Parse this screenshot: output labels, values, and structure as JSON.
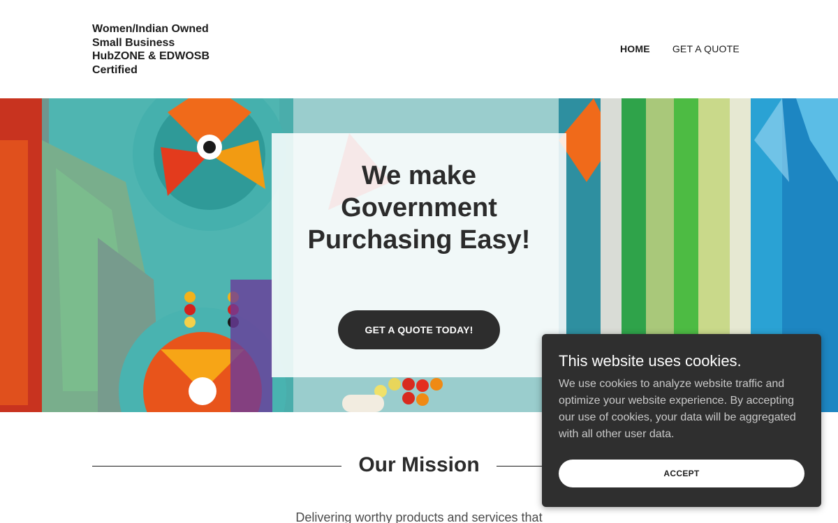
{
  "header": {
    "brand_lines": [
      "Women/Indian Owned",
      "Small Business",
      "HubZONE & EDWOSB",
      "Certified"
    ],
    "nav": [
      {
        "label": "HOME",
        "active": true
      },
      {
        "label": "GET A QUOTE",
        "active": false
      }
    ]
  },
  "hero": {
    "title": "We make Government Purchasing Easy!",
    "cta_label": "GET A QUOTE TODAY!",
    "background_image": "beaded-regalia-photo"
  },
  "mission": {
    "title": "Our Mission",
    "text": "Delivering worthy products and services that"
  },
  "cookie_banner": {
    "title": "This website uses cookies.",
    "body": "We use cookies to analyze website traffic and optimize your website experience. By accepting our use of cookies, your data will be aggregated with all other user data.",
    "accept_label": "ACCEPT"
  },
  "colors": {
    "dark_button": "#2d2d2d",
    "cookie_bg": "#2f2f2f",
    "text": "#1b1b1b"
  }
}
